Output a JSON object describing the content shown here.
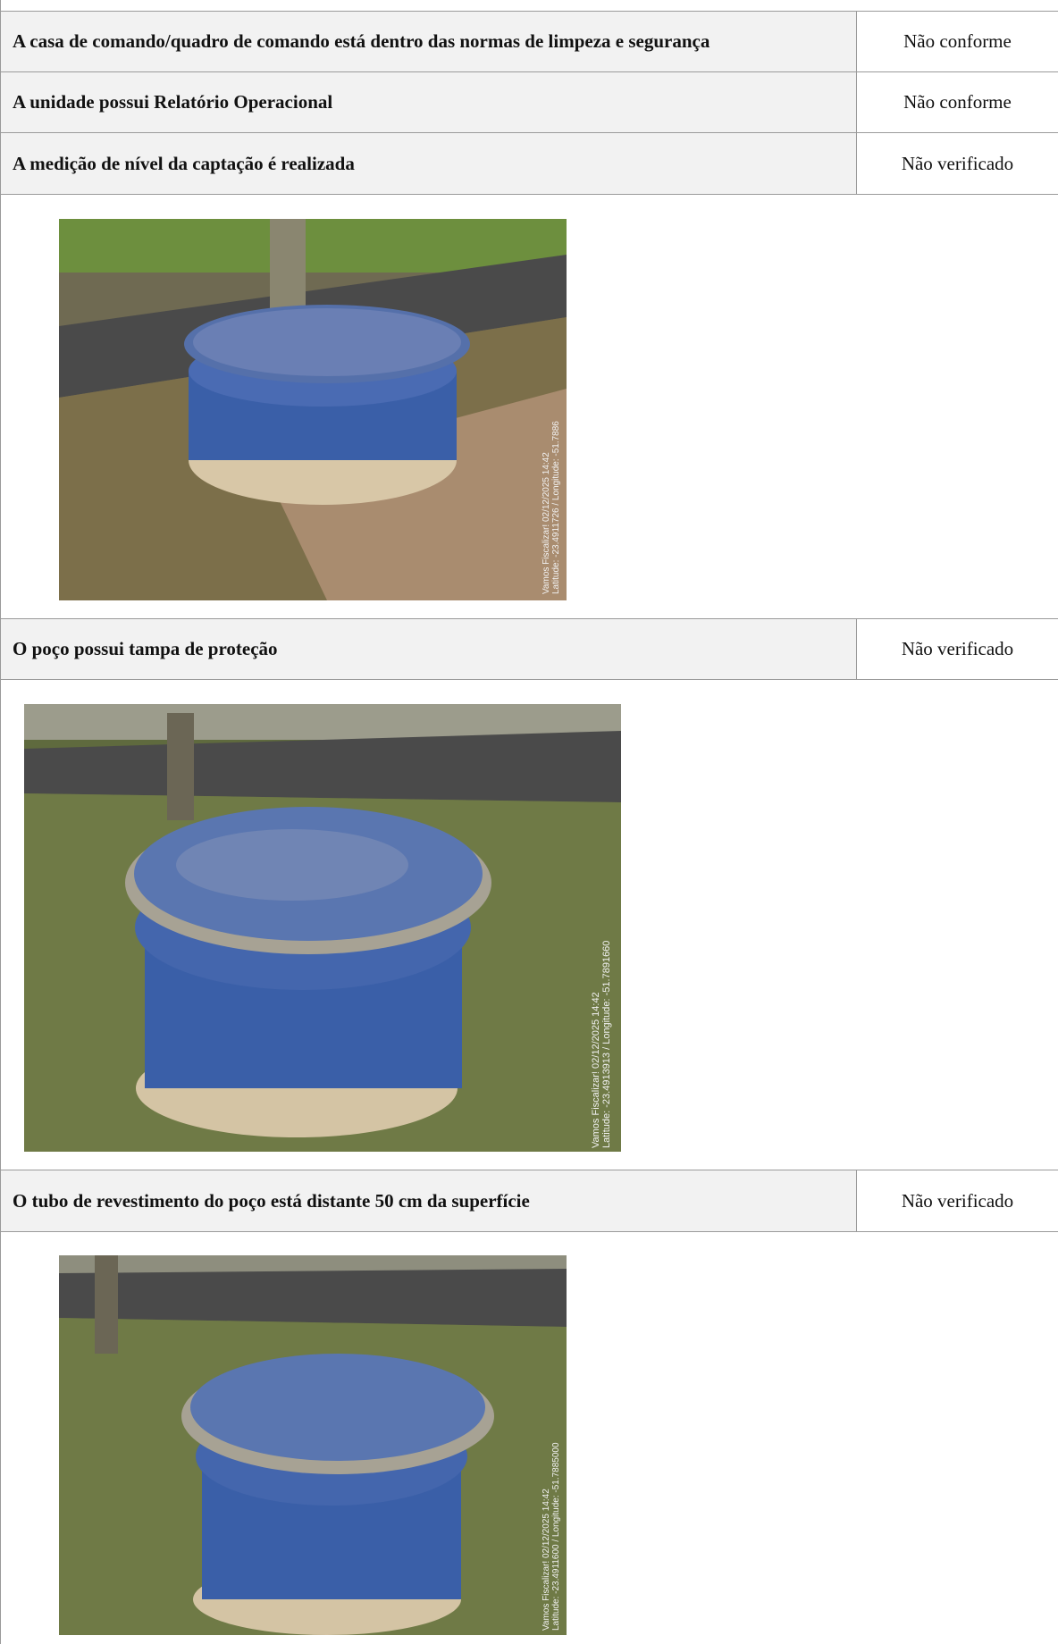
{
  "rows": [
    {
      "question": "A casa de comando/quadro de comando está dentro das normas de limpeza e segurança",
      "status": "Não conforme"
    },
    {
      "question": "A unidade possui Relatório Operacional",
      "status": "Não conforme"
    },
    {
      "question": "A medição de nível da captação é realizada",
      "status": "Não verificado"
    },
    {
      "question": "O poço possui tampa de proteção",
      "status": "Não verificado"
    },
    {
      "question": "O tubo de revestimento do poço está distante 50 cm da superfície",
      "status": "Não verificado"
    }
  ],
  "photos": [
    {
      "stamp_line1": "Vamos Fiscalizar! 02/12/2025 14:42",
      "stamp_line2": "Latitude: -23.4911726 / Longitude: -51.7886"
    },
    {
      "stamp_line1": "Vamos Fiscalizar! 02/12/2025 14:42",
      "stamp_line2": "Latitude: -23.4913913 / Longitude: -51.7891660"
    },
    {
      "stamp_line1": "Vamos Fiscalizar! 02/12/2025 14:42",
      "stamp_line2": "Latitude: -23.4911600 / Longitude: -51.7885000"
    }
  ],
  "colors": {
    "row_bg": "#f2f2f2",
    "border": "#9a9a9a",
    "well_blue": "#3a5fa8"
  }
}
